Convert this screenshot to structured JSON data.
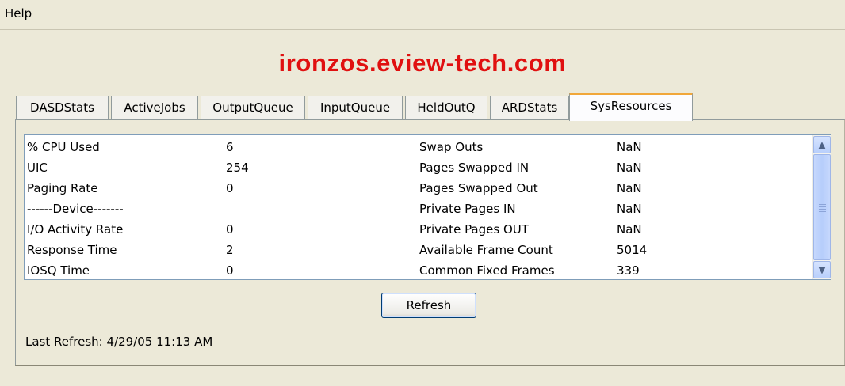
{
  "menu": {
    "items": [
      "Help"
    ]
  },
  "header": {
    "host": "ironzos.eview-tech.com"
  },
  "tabs": [
    {
      "label": "DASDStats",
      "selected": false
    },
    {
      "label": "ActiveJobs",
      "selected": false
    },
    {
      "label": "OutputQueue",
      "selected": false
    },
    {
      "label": "InputQueue",
      "selected": false
    },
    {
      "label": "HeldOutQ",
      "selected": false
    },
    {
      "label": "ARDStats",
      "selected": false
    },
    {
      "label": "SysResources",
      "selected": true
    }
  ],
  "resources": {
    "rows": [
      [
        "% CPU Used",
        "6",
        "Swap Outs",
        "NaN"
      ],
      [
        "UIC",
        "254",
        "Pages Swapped IN",
        "NaN"
      ],
      [
        "Paging Rate",
        "0",
        "Pages Swapped Out",
        "NaN"
      ],
      [
        "------Device-------",
        "",
        "Private Pages IN",
        "NaN"
      ],
      [
        "I/O Activity Rate",
        "0",
        "Private Pages OUT",
        "NaN"
      ],
      [
        "Response Time",
        "2",
        "Available Frame Count",
        "5014"
      ],
      [
        "IOSQ Time",
        "0",
        "Common Fixed Frames",
        "339"
      ]
    ]
  },
  "actions": {
    "refresh_label": "Refresh"
  },
  "status": {
    "last_refresh": "Last Refresh: 4/29/05 11:13 AM"
  },
  "colors": {
    "title_red": "#e01010",
    "window_bg": "#ece9d8",
    "selected_tab_accent": "#f1a73a"
  },
  "icons": {
    "scroll_up": "scroll-up-arrow-icon",
    "scroll_down": "scroll-down-arrow-icon"
  }
}
